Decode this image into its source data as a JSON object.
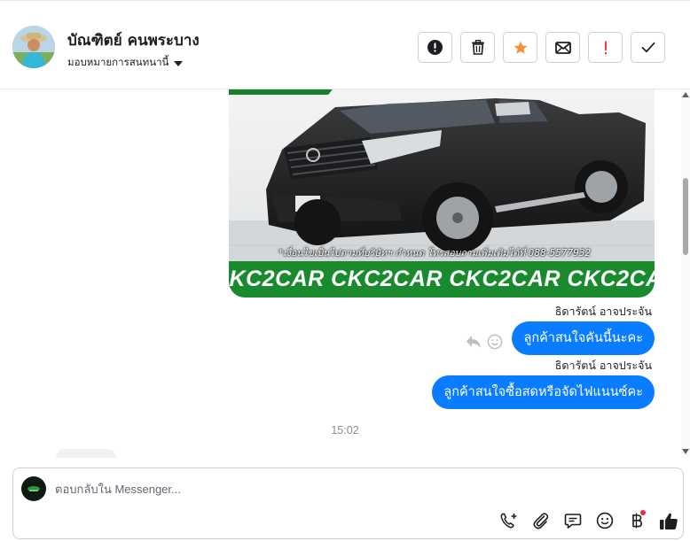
{
  "header": {
    "contact_name": "บัณฑิตย์ คนพระบาง",
    "assign_label": "มอบหมายการสนทนานี้",
    "actions": [
      {
        "name": "mark-spam",
        "icon": "exclamation-circle-icon"
      },
      {
        "name": "delete",
        "icon": "trash-icon"
      },
      {
        "name": "star",
        "icon": "star-icon",
        "color": "#f7923b"
      },
      {
        "name": "mark-unread",
        "icon": "envelope-icon"
      },
      {
        "name": "follow-up",
        "icon": "exclamation-icon",
        "color": "#fa383e"
      },
      {
        "name": "mark-done",
        "icon": "check-icon"
      }
    ]
  },
  "thread": {
    "photo": {
      "caption": "*เงื่อนไขเป็นไปตามที่บริษัทฯ กำหนด โทรสอบถามเพิ่มเติมได้ที่ 088-5577932",
      "banner": "CKC2CAR CKC2CAR CKC2CAR CKC2CAR CKC2"
    },
    "messages": [
      {
        "sender": "ธิดารัตน์ อาจประจัน",
        "text": "ลูกค้าสนใจคันนี้นะคะ"
      },
      {
        "sender": "ธิดารัตน์ อาจประจัน",
        "text": "ลูกค้าสนใจซื้อสดหรือจัดไฟแนนซ์คะ"
      }
    ],
    "time_separator": "15:02"
  },
  "composer": {
    "placeholder": "ตอบกลับใน Messenger...",
    "tools": [
      "call-add-icon",
      "paperclip-icon",
      "saved-reply-icon",
      "emoji-icon",
      "baht-payment-icon",
      "thumbs-up-icon"
    ]
  },
  "colors": {
    "accent": "#0a7cff",
    "star": "#f7923b",
    "alert": "#fa383e",
    "banner_green": "#1a8a2e"
  }
}
